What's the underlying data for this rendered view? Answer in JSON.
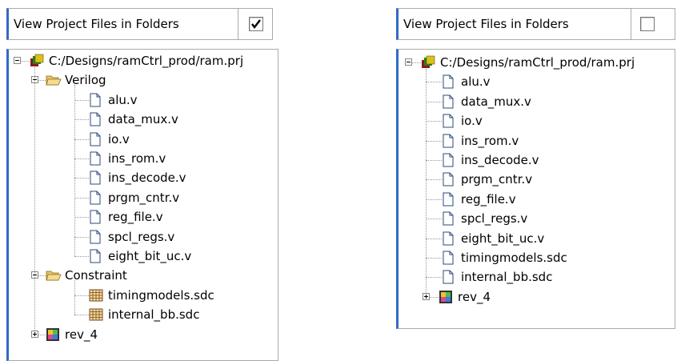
{
  "left": {
    "option_label": "View Project Files in Folders",
    "checked": true,
    "project_path": "C:/Designs/ramCtrl_prod/ram.prj",
    "folders": [
      {
        "name": "Verilog",
        "files": [
          "alu.v",
          "data_mux.v",
          "io.v",
          "ins_rom.v",
          "ins_decode.v",
          "prgm_cntr.v",
          "reg_file.v",
          "spcl_regs.v",
          "eight_bit_uc.v"
        ]
      },
      {
        "name": "Constraint",
        "files": [
          "timingmodels.sdc",
          "internal_bb.sdc"
        ]
      }
    ],
    "revision": "rev_4"
  },
  "right": {
    "option_label": "View Project Files in Folders",
    "checked": false,
    "project_path": "C:/Designs/ramCtrl_prod/ram.prj",
    "files": [
      "alu.v",
      "data_mux.v",
      "io.v",
      "ins_rom.v",
      "ins_decode.v",
      "prgm_cntr.v",
      "reg_file.v",
      "spcl_regs.v",
      "eight_bit_uc.v",
      "timingmodels.sdc",
      "internal_bb.sdc"
    ],
    "revision": "rev_4"
  }
}
